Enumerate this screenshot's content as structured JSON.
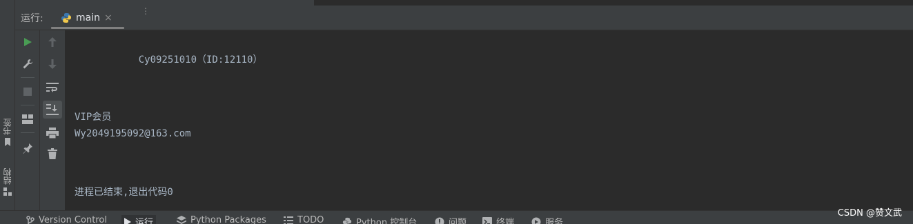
{
  "header": {
    "run_label": "运行:",
    "tab": {
      "name": "main",
      "close": "×",
      "icon": "python-icon"
    },
    "more": "⋮"
  },
  "left_strip": {
    "bookmarks_label": "书签",
    "bookmarks_icon": "bookmark-icon",
    "structure_label": "结构",
    "structure_icon": "structure-icon"
  },
  "toolbar": {
    "buttons": [
      {
        "name": "rerun",
        "icon": "play-icon"
      },
      {
        "name": "edit-configuration",
        "icon": "wrench-icon"
      },
      {
        "name": "stop",
        "icon": "stop-icon"
      },
      {
        "name": "layout",
        "icon": "layout-icon"
      },
      {
        "name": "pin-tab",
        "icon": "pin-icon"
      }
    ],
    "secondary": [
      {
        "name": "up-stack-trace",
        "icon": "arrow-up-icon"
      },
      {
        "name": "down-stack-trace",
        "icon": "arrow-down-icon"
      },
      {
        "name": "soft-wrap",
        "icon": "soft-wrap-icon"
      },
      {
        "name": "scroll-to-end",
        "icon": "scroll-end-icon"
      },
      {
        "name": "print",
        "icon": "print-icon"
      },
      {
        "name": "clear-all",
        "icon": "trash-icon"
      }
    ]
  },
  "console": {
    "lines": [
      "           Cy09251010（ID:12110）",
      "VIP会员",
      "Wy2049195092@163.com",
      "进程已结束,退出代码0"
    ]
  },
  "bottom_bar": {
    "items": [
      {
        "label": "Version Control",
        "icon": "branch-icon"
      },
      {
        "label": "运行",
        "icon": "run-icon"
      },
      {
        "label": "Python Packages",
        "icon": "layers-icon"
      },
      {
        "label": "TODO",
        "icon": "list-icon"
      },
      {
        "label": "Python 控制台",
        "icon": "python-icon"
      },
      {
        "label": "问题",
        "icon": "warning-icon"
      },
      {
        "label": "终端",
        "icon": "terminal-icon"
      },
      {
        "label": "服务",
        "icon": "services-icon"
      }
    ]
  },
  "watermark": "CSDN @赞文武",
  "colors": {
    "background": "#2b2b2b",
    "panel": "#3c3f41",
    "run_green": "#499c54",
    "text": "#bbbbbb"
  }
}
